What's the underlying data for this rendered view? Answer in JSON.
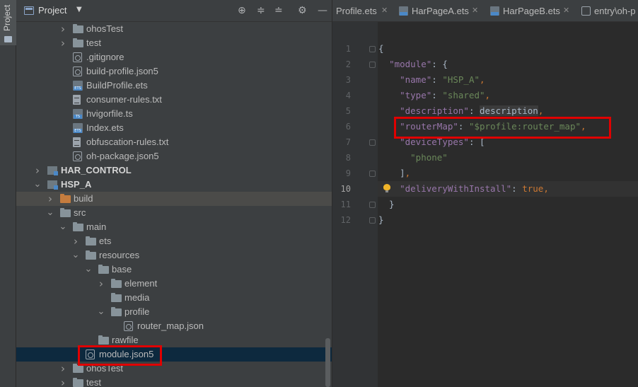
{
  "sidebar_strip": {
    "project_tab_label": "Project"
  },
  "project_panel": {
    "title": "Project",
    "tools": [
      "locate-icon",
      "expand-all-icon",
      "collapse-all-icon",
      "settings-icon"
    ],
    "tree": [
      {
        "label": "ohosTest",
        "kind": "folder",
        "expanded": false,
        "depth": 4
      },
      {
        "label": "test",
        "kind": "folder",
        "expanded": false,
        "depth": 4
      },
      {
        "label": ".gitignore",
        "kind": "config",
        "depth": 4
      },
      {
        "label": "build-profile.json5",
        "kind": "json",
        "depth": 4
      },
      {
        "label": "BuildProfile.ets",
        "kind": "ets",
        "depth": 4
      },
      {
        "label": "consumer-rules.txt",
        "kind": "text",
        "depth": 4
      },
      {
        "label": "hvigorfile.ts",
        "kind": "ts",
        "depth": 4
      },
      {
        "label": "Index.ets",
        "kind": "ets",
        "depth": 4
      },
      {
        "label": "obfuscation-rules.txt",
        "kind": "text",
        "depth": 4
      },
      {
        "label": "oh-package.json5",
        "kind": "json",
        "depth": 4
      },
      {
        "label": "HAR_CONTROL",
        "kind": "module",
        "expanded": false,
        "depth": 2
      },
      {
        "label": "HSP_A",
        "kind": "module",
        "expanded": true,
        "depth": 2
      },
      {
        "label": "build",
        "kind": "folder-orange",
        "expanded": false,
        "depth": 3
      },
      {
        "label": "src",
        "kind": "folder",
        "expanded": true,
        "depth": 3
      },
      {
        "label": "main",
        "kind": "folder",
        "expanded": true,
        "depth": 4
      },
      {
        "label": "ets",
        "kind": "folder",
        "expanded": false,
        "depth": 5
      },
      {
        "label": "resources",
        "kind": "folder",
        "expanded": true,
        "depth": 5
      },
      {
        "label": "base",
        "kind": "folder",
        "expanded": true,
        "depth": 6
      },
      {
        "label": "element",
        "kind": "folder",
        "expanded": false,
        "depth": 7
      },
      {
        "label": "media",
        "kind": "folder",
        "depth": 7
      },
      {
        "label": "profile",
        "kind": "folder",
        "expanded": true,
        "depth": 7
      },
      {
        "label": "router_map.json",
        "kind": "json",
        "depth": 8
      },
      {
        "label": "rawfile",
        "kind": "folder",
        "depth": 6
      },
      {
        "label": "module.json5",
        "kind": "json",
        "depth": 5,
        "selected": true
      },
      {
        "label": "ohosTest",
        "kind": "folder",
        "expanded": false,
        "depth": 4
      },
      {
        "label": "test",
        "kind": "folder",
        "expanded": false,
        "depth": 4
      }
    ]
  },
  "editor": {
    "tabs": [
      {
        "name": "Profile.ets",
        "icon": "ets-file-icon"
      },
      {
        "name": "HarPageA.ets",
        "icon": "ets-file-icon"
      },
      {
        "name": "HarPageB.ets",
        "icon": "ets-file-icon"
      },
      {
        "name": "entry\\oh-p",
        "icon": "json-file-icon"
      }
    ],
    "current_line": 10,
    "lines": [
      {
        "n": "1",
        "tokens": [
          [
            "p",
            "{"
          ]
        ]
      },
      {
        "n": "2",
        "tokens": [
          [
            "p",
            "  "
          ],
          [
            "k",
            "\"module\""
          ],
          [
            "p",
            ": {"
          ]
        ]
      },
      {
        "n": "3",
        "tokens": [
          [
            "p",
            "    "
          ],
          [
            "k",
            "\"name\""
          ],
          [
            "p",
            ": "
          ],
          [
            "s",
            "\"HSP_A\""
          ],
          [
            "c",
            ","
          ]
        ]
      },
      {
        "n": "4",
        "tokens": [
          [
            "p",
            "    "
          ],
          [
            "k",
            "\"type\""
          ],
          [
            "p",
            ": "
          ],
          [
            "s",
            "\"shared\""
          ],
          [
            "c",
            ","
          ]
        ]
      },
      {
        "n": "5",
        "tokens": [
          [
            "p",
            "    "
          ],
          [
            "k",
            "\"description\""
          ],
          [
            "p",
            ": "
          ],
          [
            "hl",
            "description"
          ],
          [
            "c",
            ","
          ]
        ]
      },
      {
        "n": "6",
        "tokens": [
          [
            "p",
            "    "
          ],
          [
            "k",
            "\"routerMap\""
          ],
          [
            "p",
            ": "
          ],
          [
            "s",
            "\"$profile:router_map\""
          ],
          [
            "c",
            ","
          ]
        ]
      },
      {
        "n": "7",
        "tokens": [
          [
            "p",
            "    "
          ],
          [
            "k",
            "\"deviceTypes\""
          ],
          [
            "p",
            ": ["
          ]
        ]
      },
      {
        "n": "8",
        "tokens": [
          [
            "p",
            "      "
          ],
          [
            "s",
            "\"phone\""
          ]
        ]
      },
      {
        "n": "9",
        "tokens": [
          [
            "p",
            "    ]"
          ],
          [
            "c",
            ","
          ]
        ]
      },
      {
        "n": "10",
        "tokens": [
          [
            "p",
            "    "
          ],
          [
            "k",
            "\"deliveryWithInstall\""
          ],
          [
            "p",
            ": "
          ],
          [
            "kw",
            "true"
          ],
          [
            "c",
            ","
          ]
        ]
      },
      {
        "n": "11",
        "tokens": [
          [
            "p",
            "  }"
          ]
        ]
      },
      {
        "n": "12",
        "tokens": [
          [
            "p",
            "}"
          ]
        ]
      }
    ]
  },
  "colors": {
    "panel_bg": "#3c3f41",
    "editor_bg": "#2b2b2b",
    "selection": "#0d293e",
    "annotation_red": "#e00000",
    "json_key": "#9876aa",
    "json_string": "#6a8759",
    "keyword": "#cc7832"
  }
}
